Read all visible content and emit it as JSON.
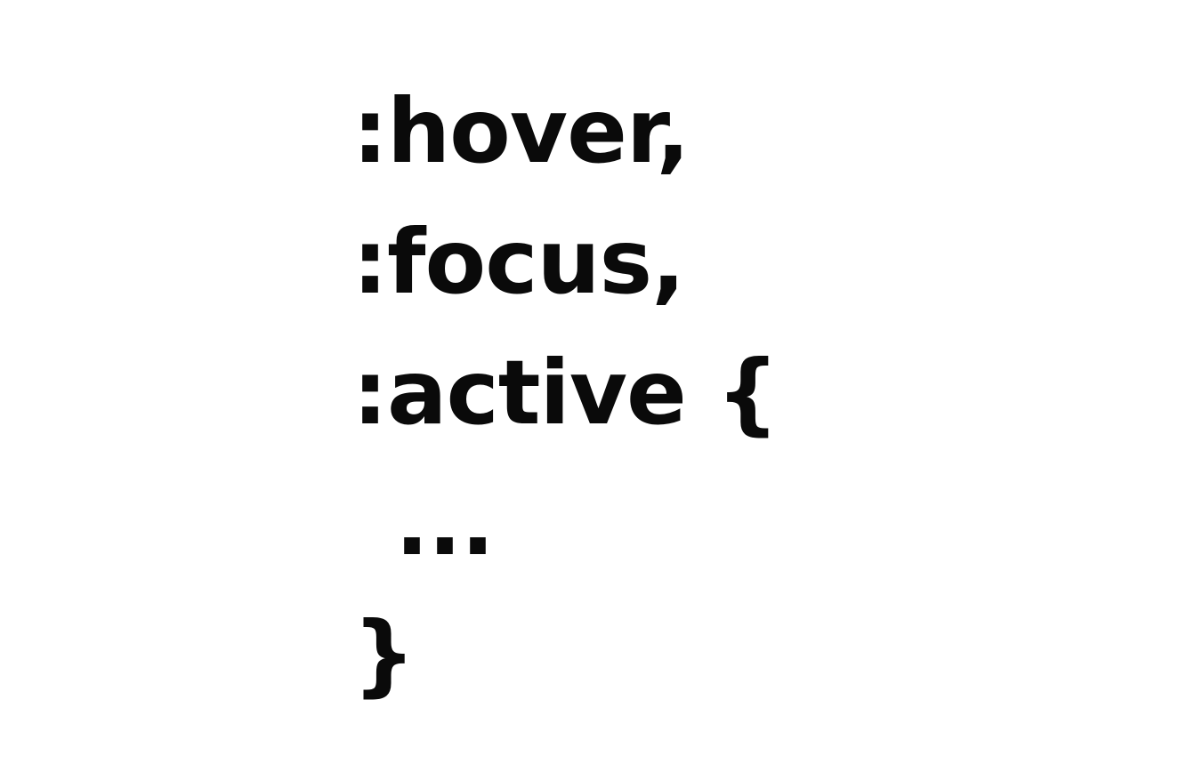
{
  "code": {
    "lines": [
      ":hover,",
      ":focus,",
      ":active {",
      "...",
      "}"
    ]
  }
}
